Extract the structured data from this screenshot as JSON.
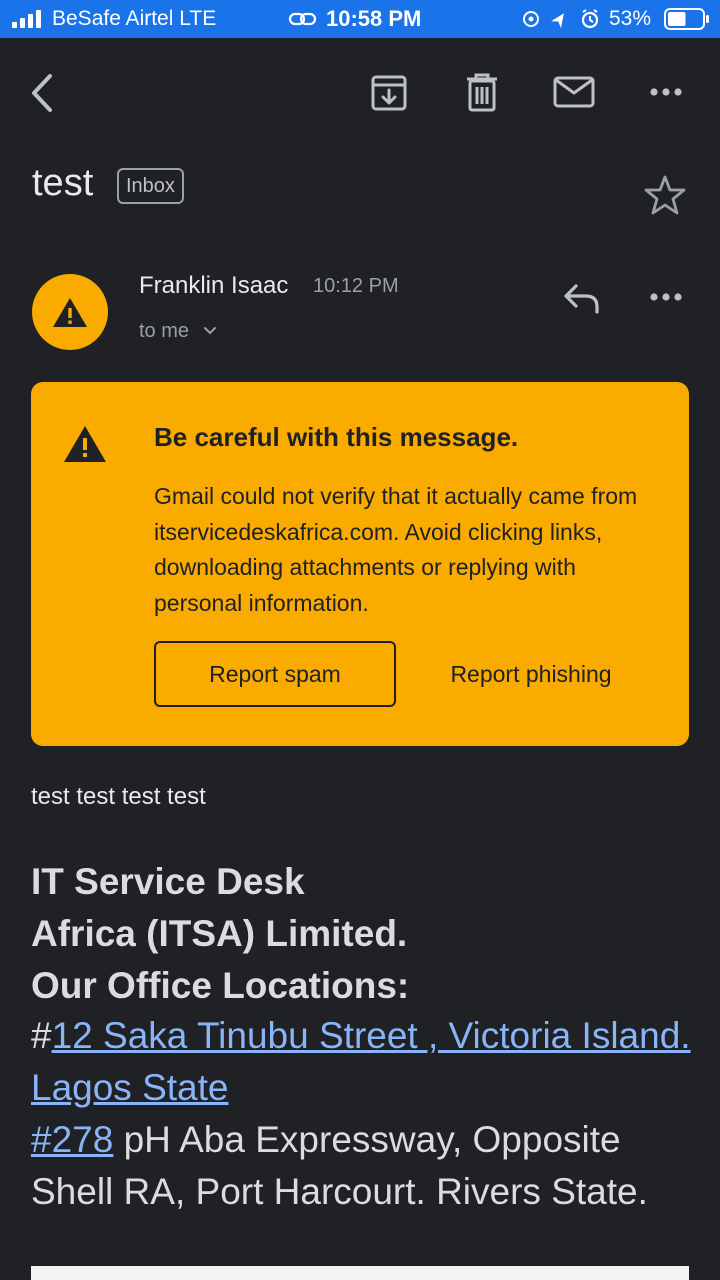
{
  "status_bar": {
    "carrier": "BeSafe Airtel  LTE",
    "time": "10:58 PM",
    "battery_percent": "53%",
    "battery_level": 0.53,
    "accent_color": "#1a73e8"
  },
  "toolbar": {
    "back_icon": "back-arrow-icon",
    "archive_icon": "archive-icon",
    "delete_icon": "trash-icon",
    "unread_icon": "mail-icon",
    "more_icon": "more-horizontal-icon"
  },
  "email": {
    "subject": "test",
    "label": "Inbox",
    "sender_name": "Franklin Isaac",
    "time": "10:12 PM",
    "recipient": "to me"
  },
  "warning": {
    "title": "Be careful with this message.",
    "body": "Gmail could not verify that it actually came from itservicedeskafrica.com. Avoid clicking links, downloading attachments or replying with personal information.",
    "report_spam": "Report spam",
    "report_phishing": "Report phishing",
    "color": "#f9ab00"
  },
  "message": {
    "line1": "test test test test",
    "company_line1": "IT Service Desk",
    "company_line2": "Africa (ITSA) Limited.",
    "company_line3": "Our Office Locations:",
    "addr1_prefix": "#",
    "addr1_link": "12 Saka Tinubu Street , Victoria Island. Lagos State",
    "addr2_link": "#278",
    "addr2_rest": " pH Aba Expressway, Opposite Shell RA, Port Harcourt. Rivers State.",
    "link_color": "#8ab4f8"
  }
}
